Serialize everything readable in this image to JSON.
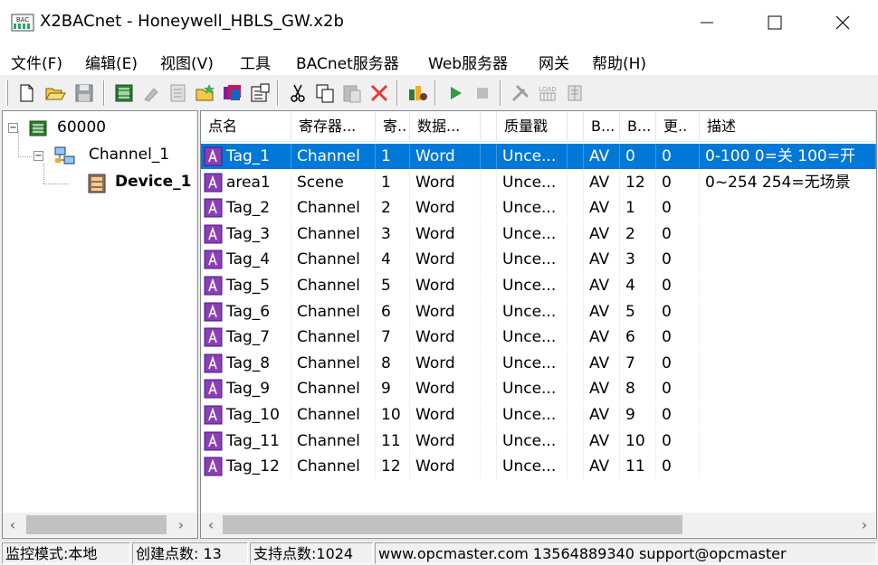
{
  "window": {
    "title": "X2BACnet - Honeywell_HBLS_GW.x2b"
  },
  "menu": [
    "文件(F)",
    "编辑(E)",
    "视图(V)",
    "工具",
    "BACnet服务器",
    "Web服务器",
    "网关",
    "帮助(H)"
  ],
  "toolbar": {
    "buttons": [
      "new-icon",
      "open-icon",
      "save-icon",
      "add-device-icon",
      "delete-device-icon",
      "properties-icon",
      "add-folder-icon",
      "add-tag-icon",
      "settings-icon",
      "cut-icon",
      "copy-icon",
      "paste-icon",
      "delete-icon",
      "monitor-icon",
      "start-icon",
      "stop-icon",
      "tools-icon",
      "load-icon",
      "batch-icon"
    ],
    "load_label": "LOAD"
  },
  "tree": {
    "root": "60000",
    "channel": "Channel_1",
    "device": "Device_1"
  },
  "table": {
    "columns": [
      "点名",
      "寄存器...",
      "寄..",
      "数据...",
      "",
      "质量戳",
      "",
      "B...",
      "B...",
      "更..",
      "描述"
    ],
    "rows": [
      {
        "name": "Tag_1",
        "register": "Channel",
        "reg_no": "1",
        "data_type": "Word",
        "quality": "Unce...",
        "b_type": "AV",
        "b_no": "0",
        "update": "0",
        "desc": "0-100 0=关 100=开"
      },
      {
        "name": "area1",
        "register": "Scene",
        "reg_no": "1",
        "data_type": "Word",
        "quality": "Unce...",
        "b_type": "AV",
        "b_no": "12",
        "update": "0",
        "desc": "0~254  254=无场景"
      },
      {
        "name": "Tag_2",
        "register": "Channel",
        "reg_no": "2",
        "data_type": "Word",
        "quality": "Unce...",
        "b_type": "AV",
        "b_no": "1",
        "update": "0",
        "desc": ""
      },
      {
        "name": "Tag_3",
        "register": "Channel",
        "reg_no": "3",
        "data_type": "Word",
        "quality": "Unce...",
        "b_type": "AV",
        "b_no": "2",
        "update": "0",
        "desc": ""
      },
      {
        "name": "Tag_4",
        "register": "Channel",
        "reg_no": "4",
        "data_type": "Word",
        "quality": "Unce...",
        "b_type": "AV",
        "b_no": "3",
        "update": "0",
        "desc": ""
      },
      {
        "name": "Tag_5",
        "register": "Channel",
        "reg_no": "5",
        "data_type": "Word",
        "quality": "Unce...",
        "b_type": "AV",
        "b_no": "4",
        "update": "0",
        "desc": ""
      },
      {
        "name": "Tag_6",
        "register": "Channel",
        "reg_no": "6",
        "data_type": "Word",
        "quality": "Unce...",
        "b_type": "AV",
        "b_no": "5",
        "update": "0",
        "desc": ""
      },
      {
        "name": "Tag_7",
        "register": "Channel",
        "reg_no": "7",
        "data_type": "Word",
        "quality": "Unce...",
        "b_type": "AV",
        "b_no": "6",
        "update": "0",
        "desc": ""
      },
      {
        "name": "Tag_8",
        "register": "Channel",
        "reg_no": "8",
        "data_type": "Word",
        "quality": "Unce...",
        "b_type": "AV",
        "b_no": "7",
        "update": "0",
        "desc": ""
      },
      {
        "name": "Tag_9",
        "register": "Channel",
        "reg_no": "9",
        "data_type": "Word",
        "quality": "Unce...",
        "b_type": "AV",
        "b_no": "8",
        "update": "0",
        "desc": ""
      },
      {
        "name": "Tag_10",
        "register": "Channel",
        "reg_no": "10",
        "data_type": "Word",
        "quality": "Unce...",
        "b_type": "AV",
        "b_no": "9",
        "update": "0",
        "desc": ""
      },
      {
        "name": "Tag_11",
        "register": "Channel",
        "reg_no": "11",
        "data_type": "Word",
        "quality": "Unce...",
        "b_type": "AV",
        "b_no": "10",
        "update": "0",
        "desc": ""
      },
      {
        "name": "Tag_12",
        "register": "Channel",
        "reg_no": "12",
        "data_type": "Word",
        "quality": "Unce...",
        "b_type": "AV",
        "b_no": "11",
        "update": "0",
        "desc": ""
      }
    ],
    "selected_row": 0
  },
  "status": {
    "mode": "监控模式:本地",
    "created": "创建点数: 13",
    "supported": "支持点数:1024",
    "contact": "www.opcmaster.com 13564889340 support@opcmaster"
  },
  "colors": {
    "selection": "#0078d7",
    "tag_icon": "#8a3fb3"
  }
}
